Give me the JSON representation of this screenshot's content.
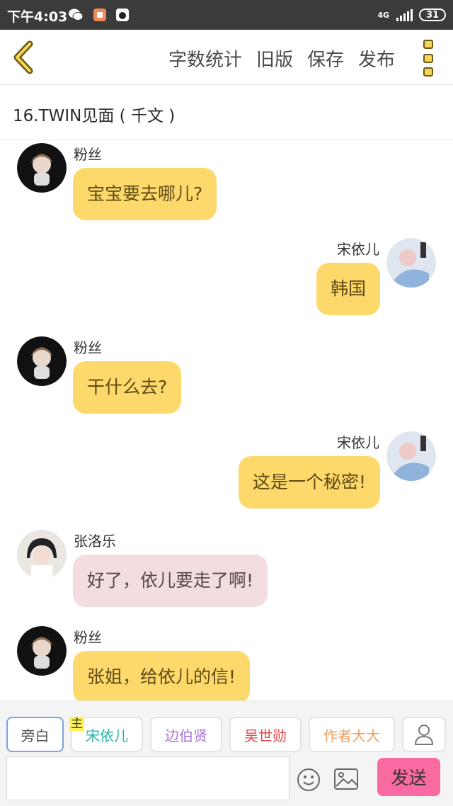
{
  "status_bar": {
    "time": "下午4:03",
    "network": "4G",
    "battery": "31",
    "icons": [
      "wechat-icon",
      "app-icon",
      "qq-icon",
      "signal-icon",
      "battery-icon"
    ]
  },
  "top_bar": {
    "back_icon": "chevron-left-icon",
    "actions": [
      "字数统计",
      "旧版",
      "保存",
      "发布"
    ],
    "more_icon": "more-vertical-icon"
  },
  "chapter_title": "16.TWIN见面 ( 千文 )",
  "messages": [
    {
      "side": "left",
      "name": "粉丝",
      "text": "宝宝要去哪儿?",
      "bubble": "yellow",
      "avatar": "fan-avatar"
    },
    {
      "side": "right",
      "name": "宋依儿",
      "text": "韩国",
      "bubble": "yellow",
      "avatar": "song-yier-avatar"
    },
    {
      "side": "left",
      "name": "粉丝",
      "text": "干什么去?",
      "bubble": "yellow",
      "avatar": "fan-avatar"
    },
    {
      "side": "right",
      "name": "宋依儿",
      "text": "这是一个秘密!",
      "bubble": "yellow",
      "avatar": "song-yier-avatar"
    },
    {
      "side": "left",
      "name": "张洛乐",
      "text": "好了，依儿要走了啊!",
      "bubble": "pink",
      "avatar": "zhang-luole-avatar"
    },
    {
      "side": "left",
      "name": "粉丝",
      "text": "张姐，给依儿的信!",
      "bubble": "yellow",
      "avatar": "fan-avatar"
    }
  ],
  "roles": [
    {
      "label": "旁白",
      "color": "#555555"
    },
    {
      "label": "宋依儿",
      "color": "#2bb3a8",
      "main_mark": "主"
    },
    {
      "label": "边伯贤",
      "color": "#a86fd4"
    },
    {
      "label": "吴世勋",
      "color": "#e04848"
    },
    {
      "label": "作者大大",
      "color": "#f0a060"
    }
  ],
  "input": {
    "placeholder": "",
    "value": ""
  },
  "send_label": "发送",
  "colors": {
    "accent_yellow": "#fdd96b",
    "send_pink": "#f96aa0",
    "status_bar": "#3b3b3b"
  }
}
